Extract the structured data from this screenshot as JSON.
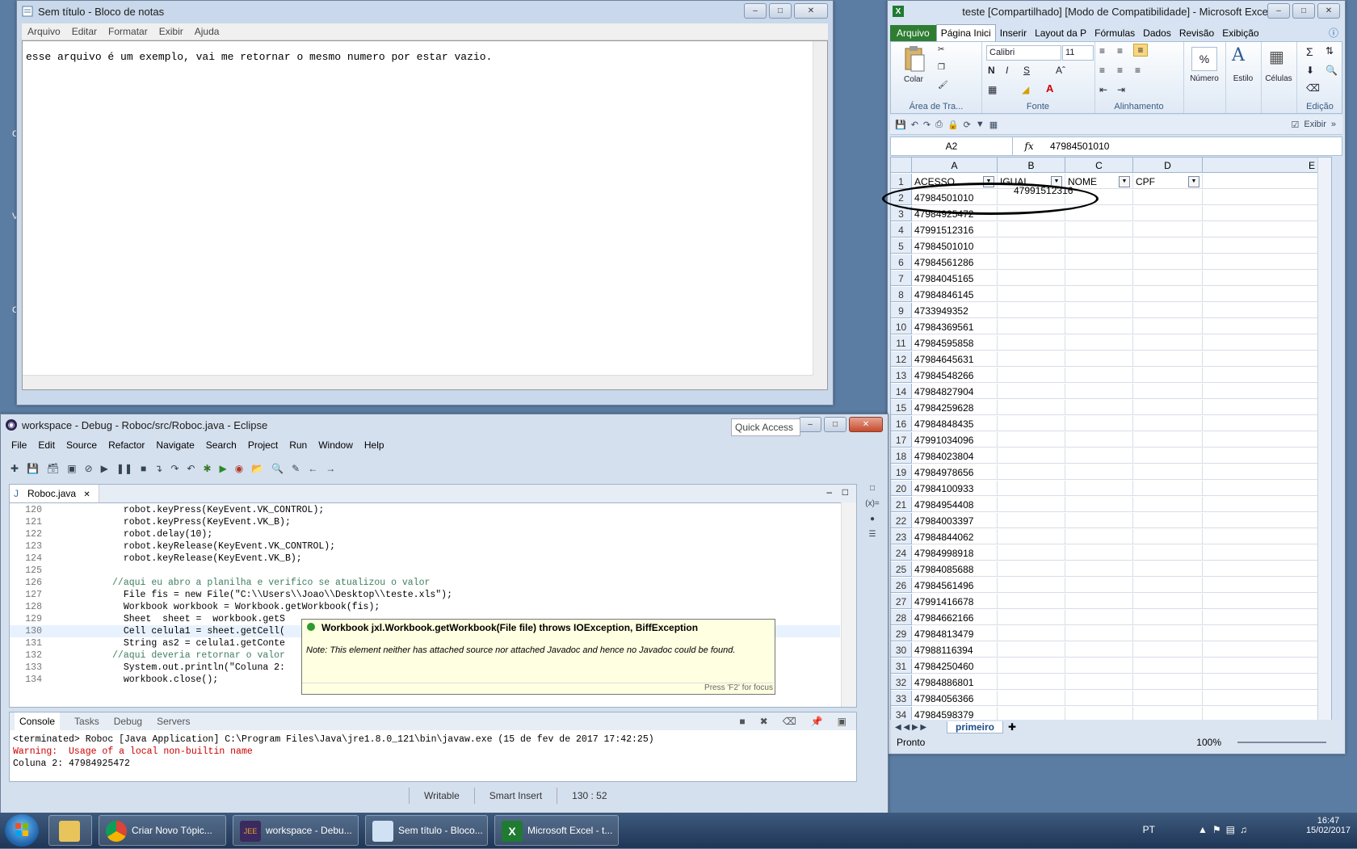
{
  "notepad": {
    "title": "Sem título - Bloco de notas",
    "menu": [
      "Arquivo",
      "Editar",
      "Formatar",
      "Exibir",
      "Ajuda"
    ],
    "content": "esse arquivo é um exemplo, vai me retornar o mesmo numero por estar vazio."
  },
  "excel": {
    "title": "teste  [Compartilhado]  [Modo de Compatibilidade]  - Microsoft Excel",
    "tabs": [
      "Arquivo",
      "Página Inici",
      "Inserir",
      "Layout da P",
      "Fórmulas",
      "Dados",
      "Revisão",
      "Exibição"
    ],
    "ribbon": {
      "paste_label": "Colar",
      "font_name": "Calibri",
      "font_size": "11",
      "group_clipboard": "Área de Tra...",
      "group_font": "Fonte",
      "group_alignment": "Alinhamento",
      "number_label": "Número",
      "style_label": "Estilo",
      "cells_label": "Células",
      "group_editing": "Edição",
      "bold": "N",
      "italic": "I",
      "underline": "S"
    },
    "qat_exibir": "Exibir",
    "name_box": "A2",
    "fx": "fx",
    "formula": "47984501010",
    "columns": [
      "A",
      "B",
      "C",
      "D",
      "E"
    ],
    "headers": [
      "ACESSO",
      "IGUAL",
      "NOME",
      "CPF"
    ],
    "row2_b": "47991512316",
    "rows": [
      {
        "n": "2",
        "a": "47984501010"
      },
      {
        "n": "3",
        "a": "47984925472"
      },
      {
        "n": "4",
        "a": "47991512316"
      },
      {
        "n": "5",
        "a": "47984501010"
      },
      {
        "n": "6",
        "a": "47984561286"
      },
      {
        "n": "7",
        "a": "47984045165"
      },
      {
        "n": "8",
        "a": "47984846145"
      },
      {
        "n": "9",
        "a": "4733949352"
      },
      {
        "n": "10",
        "a": "47984369561"
      },
      {
        "n": "11",
        "a": "47984595858"
      },
      {
        "n": "12",
        "a": "47984645631"
      },
      {
        "n": "13",
        "a": "47984548266"
      },
      {
        "n": "14",
        "a": "47984827904"
      },
      {
        "n": "15",
        "a": "47984259628"
      },
      {
        "n": "16",
        "a": "47984848435"
      },
      {
        "n": "17",
        "a": "47991034096"
      },
      {
        "n": "18",
        "a": "47984023804"
      },
      {
        "n": "19",
        "a": "47984978656"
      },
      {
        "n": "20",
        "a": "47984100933"
      },
      {
        "n": "21",
        "a": "47984954408"
      },
      {
        "n": "22",
        "a": "47984003397"
      },
      {
        "n": "23",
        "a": "47984844062"
      },
      {
        "n": "24",
        "a": "47984998918"
      },
      {
        "n": "25",
        "a": "47984085688"
      },
      {
        "n": "26",
        "a": "47984561496"
      },
      {
        "n": "27",
        "a": "47991416678"
      },
      {
        "n": "28",
        "a": "47984662166"
      },
      {
        "n": "29",
        "a": "47984813479"
      },
      {
        "n": "30",
        "a": "47988116394"
      },
      {
        "n": "31",
        "a": "47984250460"
      },
      {
        "n": "32",
        "a": "47984886801"
      },
      {
        "n": "33",
        "a": "47984056366"
      },
      {
        "n": "34",
        "a": "47984598379"
      }
    ],
    "sheet_tab": "primeiro",
    "status": "Pronto",
    "zoom": "100%"
  },
  "eclipse": {
    "title": "workspace - Debug - Roboc/src/Roboc.java - Eclipse",
    "menu": [
      "File",
      "Edit",
      "Source",
      "Refactor",
      "Navigate",
      "Search",
      "Project",
      "Run",
      "Window",
      "Help"
    ],
    "quick_access": "Quick Access",
    "editor_tab": "Roboc.java",
    "code": [
      {
        "n": "120",
        "t": "            robot.keyPress(KeyEvent.VK_CONTROL);"
      },
      {
        "n": "121",
        "t": "            robot.keyPress(KeyEvent.VK_B);"
      },
      {
        "n": "122",
        "t": "            robot.delay(10);"
      },
      {
        "n": "123",
        "t": "            robot.keyRelease(KeyEvent.VK_CONTROL);"
      },
      {
        "n": "124",
        "t": "            robot.keyRelease(KeyEvent.VK_B);"
      },
      {
        "n": "125",
        "t": ""
      },
      {
        "n": "126",
        "t": "          //aqui eu abro a planilha e verifico se atualizou o valor"
      },
      {
        "n": "127",
        "t": "            File fis = new File(\"C:\\\\Users\\\\Joao\\\\Desktop\\\\teste.xls\");"
      },
      {
        "n": "128",
        "t": "            Workbook workbook = Workbook.getWorkbook(fis);"
      },
      {
        "n": "129",
        "t": "            Sheet  sheet =  workbook.getS"
      },
      {
        "n": "130",
        "t": "            Cell celula1 = sheet.getCell("
      },
      {
        "n": "131",
        "t": "            String as2 = celula1.getConte"
      },
      {
        "n": "132",
        "t": "          //aqui deveria retornar o valor"
      },
      {
        "n": "133",
        "t": "            System.out.println(\"Coluna 2:"
      },
      {
        "n": "134",
        "t": "            workbook.close();"
      }
    ],
    "tooltip": {
      "title": "Workbook jxl.Workbook.getWorkbook(File file) throws IOException, BiffException",
      "note": "Note: This element neither has attached source nor attached Javadoc and hence no Javadoc could be found.",
      "footer": "Press 'F2' for focus"
    },
    "console_tabs": [
      "Console",
      "Tasks",
      "Debug",
      "Servers"
    ],
    "console_lines": [
      "<terminated> Roboc [Java Application] C:\\Program Files\\Java\\jre1.8.0_121\\bin\\javaw.exe (15 de fev de 2017 17:42:25)",
      "Warning:  Usage of a local non-builtin name",
      "Coluna 2: 47984925472"
    ],
    "status": [
      "Writable",
      "Smart Insert",
      "130 : 52"
    ]
  },
  "taskbar": {
    "items": [
      "Criar Novo Tópic...",
      "workspace - Debu...",
      "Sem título - Bloco...",
      "Microsoft Excel - t..."
    ],
    "lang": "PT",
    "time": "16:47",
    "date": "15/02/2017"
  },
  "colors": {
    "excel_green": "#2e7d32",
    "comment": "#3f7f5f",
    "keyword": "#7f0055",
    "string": "#2a00ff",
    "tooltip_bg": "#ffffe1"
  }
}
